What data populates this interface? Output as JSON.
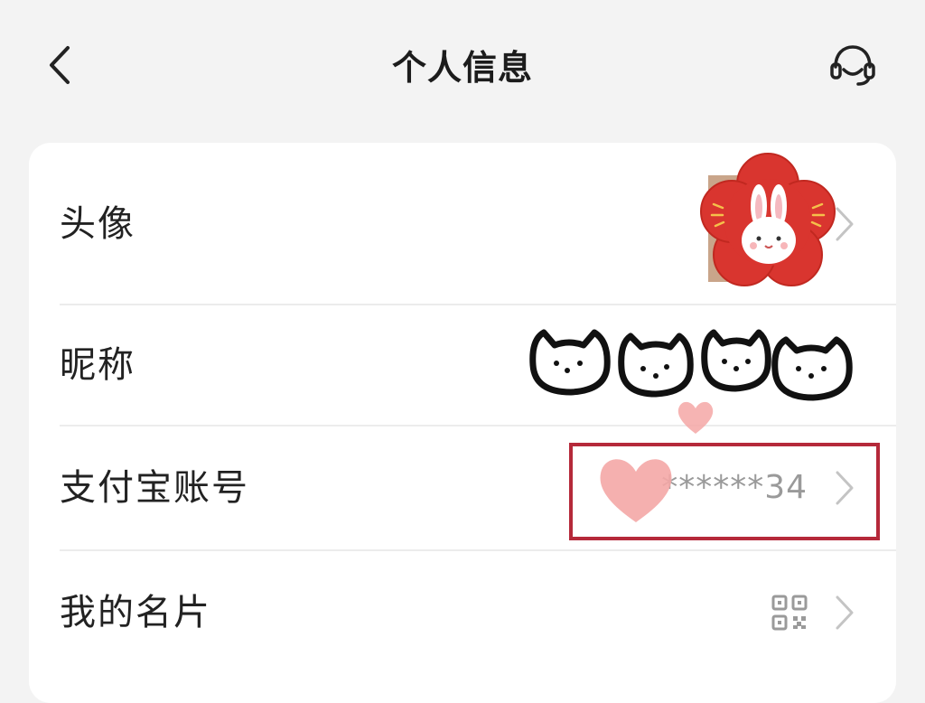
{
  "header": {
    "title": "个人信息",
    "back_icon": "chevron-left-icon",
    "support_icon": "headset-icon"
  },
  "rows": [
    {
      "label": "头像",
      "value_type": "avatar",
      "icon": "rabbit-avatar-image",
      "accent": "#d9352f"
    },
    {
      "label": "昵称",
      "value_type": "cat-sticker-art"
    },
    {
      "label": "支付宝账号",
      "value": "******34",
      "annotation": "red-highlight-box",
      "accent": "#b5293a"
    },
    {
      "label": "我的名片",
      "value_type": "qr-code-icon"
    }
  ],
  "colors": {
    "background": "#f3f3f3",
    "card": "#ffffff",
    "label": "#222222",
    "value": "#9a9a9a",
    "heart": "#f4a7a6"
  }
}
